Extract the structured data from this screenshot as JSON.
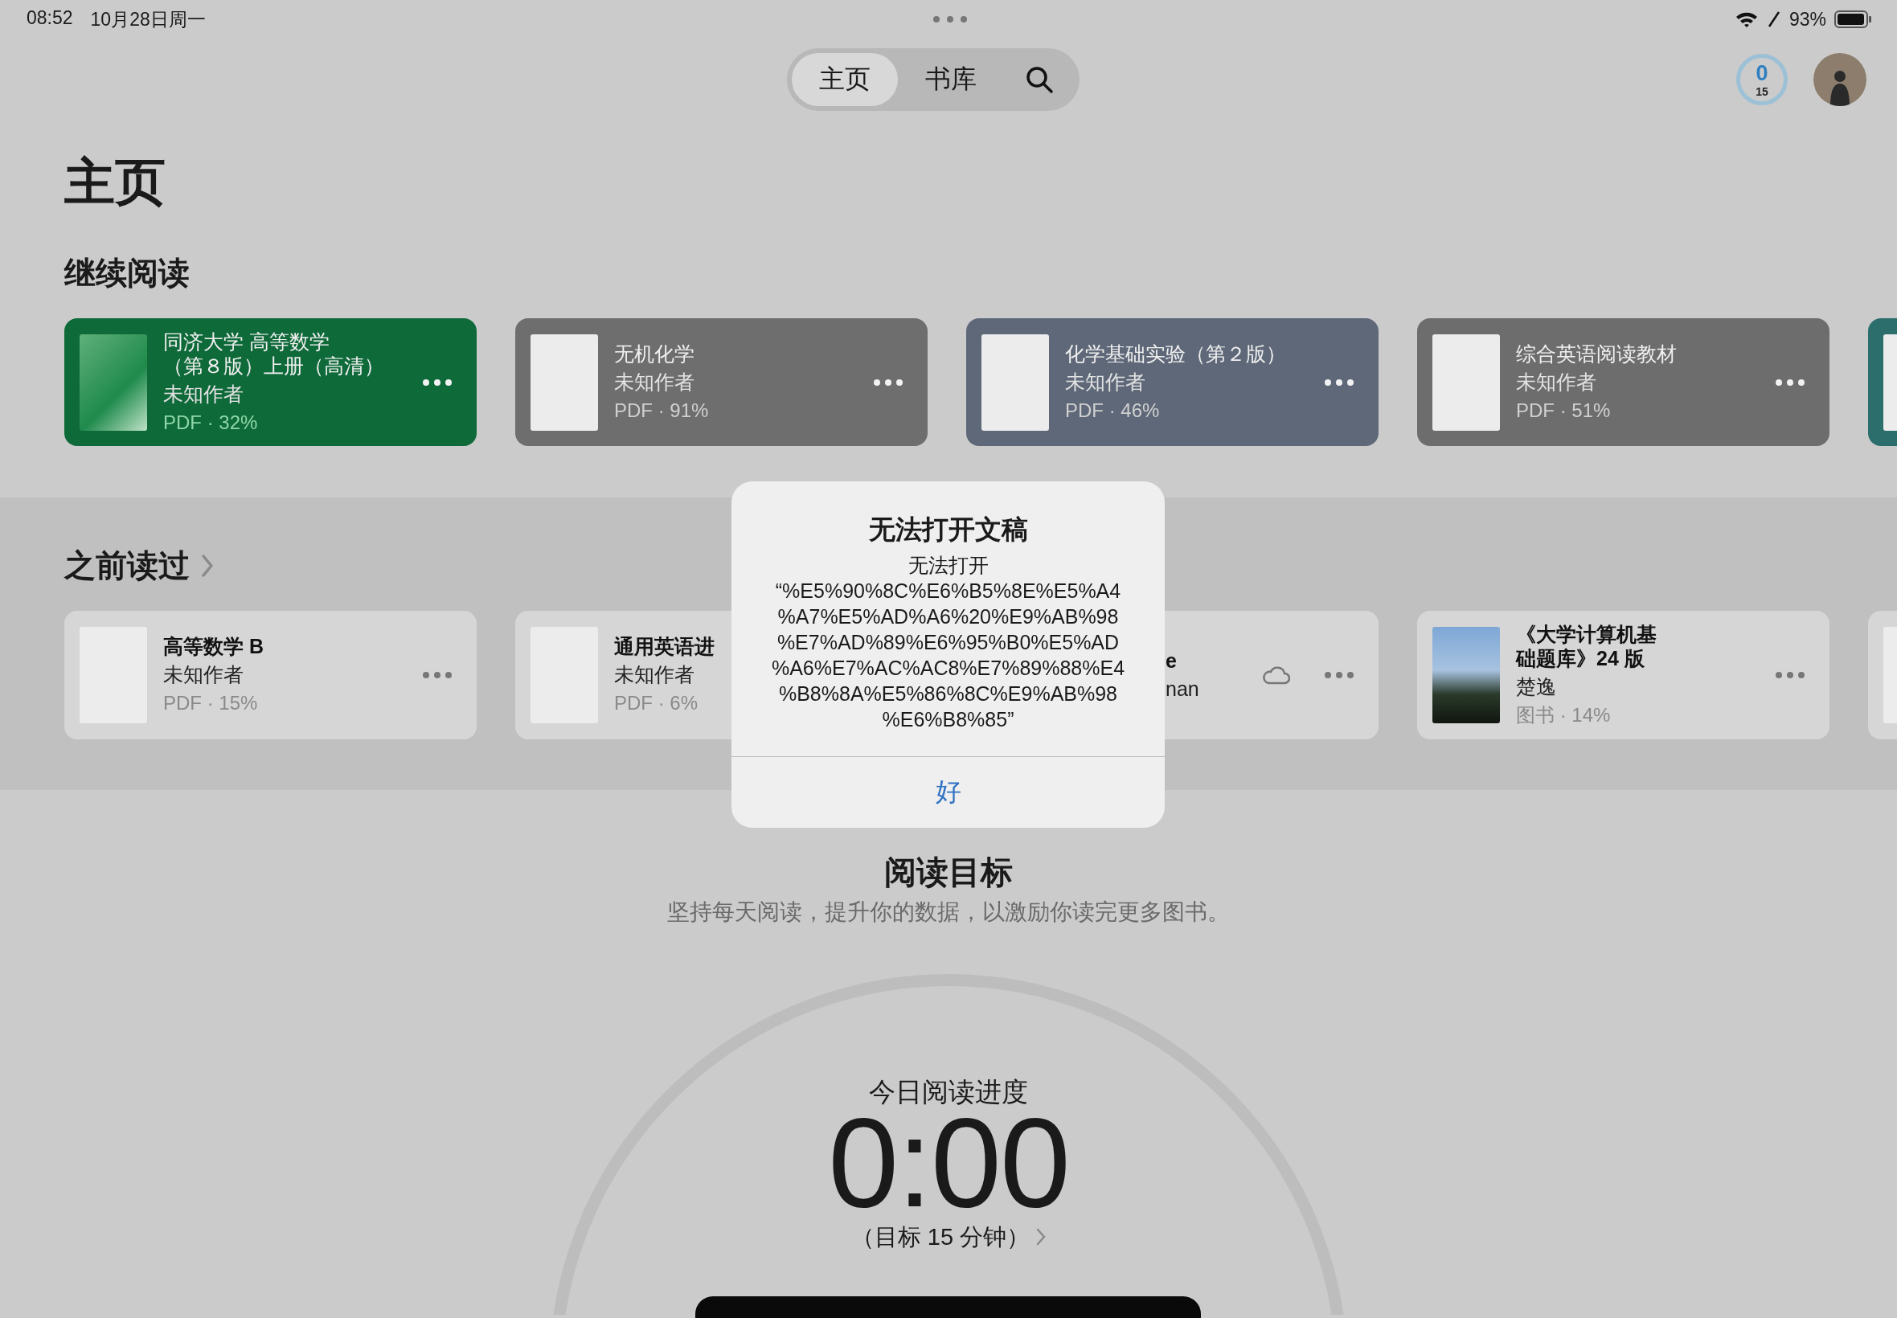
{
  "status_bar": {
    "time": "08:52",
    "date": "10月28日周一",
    "battery": "93%"
  },
  "nav": {
    "tabs": [
      {
        "label": "主页",
        "selected": true
      },
      {
        "label": "书库",
        "selected": false
      }
    ]
  },
  "goal_badge": {
    "value": "0",
    "target": "15"
  },
  "page_title": "主页",
  "continue_reading": {
    "heading": "继续阅读",
    "books": [
      {
        "kind": "book",
        "cover": {
          "kind": "tinted"
        },
        "color": "#0f6a3a",
        "title_lines": [
          "同济大学 高等数学",
          "（第８版）上册（高清）"
        ],
        "author": "未知作者",
        "meta": "PDF · 32%"
      },
      {
        "kind": "book",
        "cover": {
          "kind": "document"
        },
        "color": "#6e6e6e",
        "title": "无机化学",
        "author": "未知作者",
        "meta": "PDF · 91%"
      },
      {
        "kind": "book",
        "cover": {
          "kind": "document"
        },
        "color": "#5e6878",
        "title": "化学基础实验（第２版）",
        "author": "未知作者",
        "meta": "PDF · 46%"
      },
      {
        "kind": "book",
        "cover": {
          "kind": "document"
        },
        "color": "#6d6d6d",
        "title": "综合英语阅读教材",
        "author": "未知作者",
        "meta": "PDF · 51%"
      },
      {
        "kind": "edge",
        "cover": {
          "kind": "document"
        },
        "color": "#2b6e6c"
      }
    ]
  },
  "read_before": {
    "heading": "之前读过",
    "books": [
      {
        "kind": "book",
        "cover": {
          "kind": "document"
        },
        "in_cloud": false,
        "title": "高等数学 B",
        "author": "未知作者",
        "meta": "PDF · 15%"
      },
      {
        "kind": "book",
        "cover": {
          "kind": "document"
        },
        "in_cloud": false,
        "title": "通用英语进",
        "author": "未知作者",
        "meta": "PDF · 6%"
      },
      {
        "kind": "covered",
        "in_cloud": true,
        "title": "e",
        "author": "nan"
      },
      {
        "kind": "book",
        "cover": {
          "kind": "photo"
        },
        "in_cloud": false,
        "title_lines": [
          "《大学计算机基",
          "础题库》24 版"
        ],
        "author": "楚逸",
        "meta": "图书 · 14%"
      },
      {
        "kind": "edge",
        "cover": {
          "kind": "document"
        },
        "in_cloud": false
      }
    ]
  },
  "reading_goal": {
    "heading": "阅读目标",
    "description": "坚持每天阅读，提升你的数据，以激励你读完更多图书。",
    "today_label": "今日阅读进度",
    "time": "0:00",
    "target": "（目标 15 分钟）"
  },
  "alert": {
    "title": "无法打开文稿",
    "message": "无法打开\n“%E5%90%8C%E6%B5%8E%E5%A4\n%A7%E5%AD%A6%20%E9%AB%98\n%E7%AD%89%E6%95%B0%E5%AD\n%A6%E7%AC%AC8%E7%89%88%E4\n%B8%8A%E5%86%8C%E9%AB%98\n%E6%B8%85”",
    "button": "好"
  }
}
